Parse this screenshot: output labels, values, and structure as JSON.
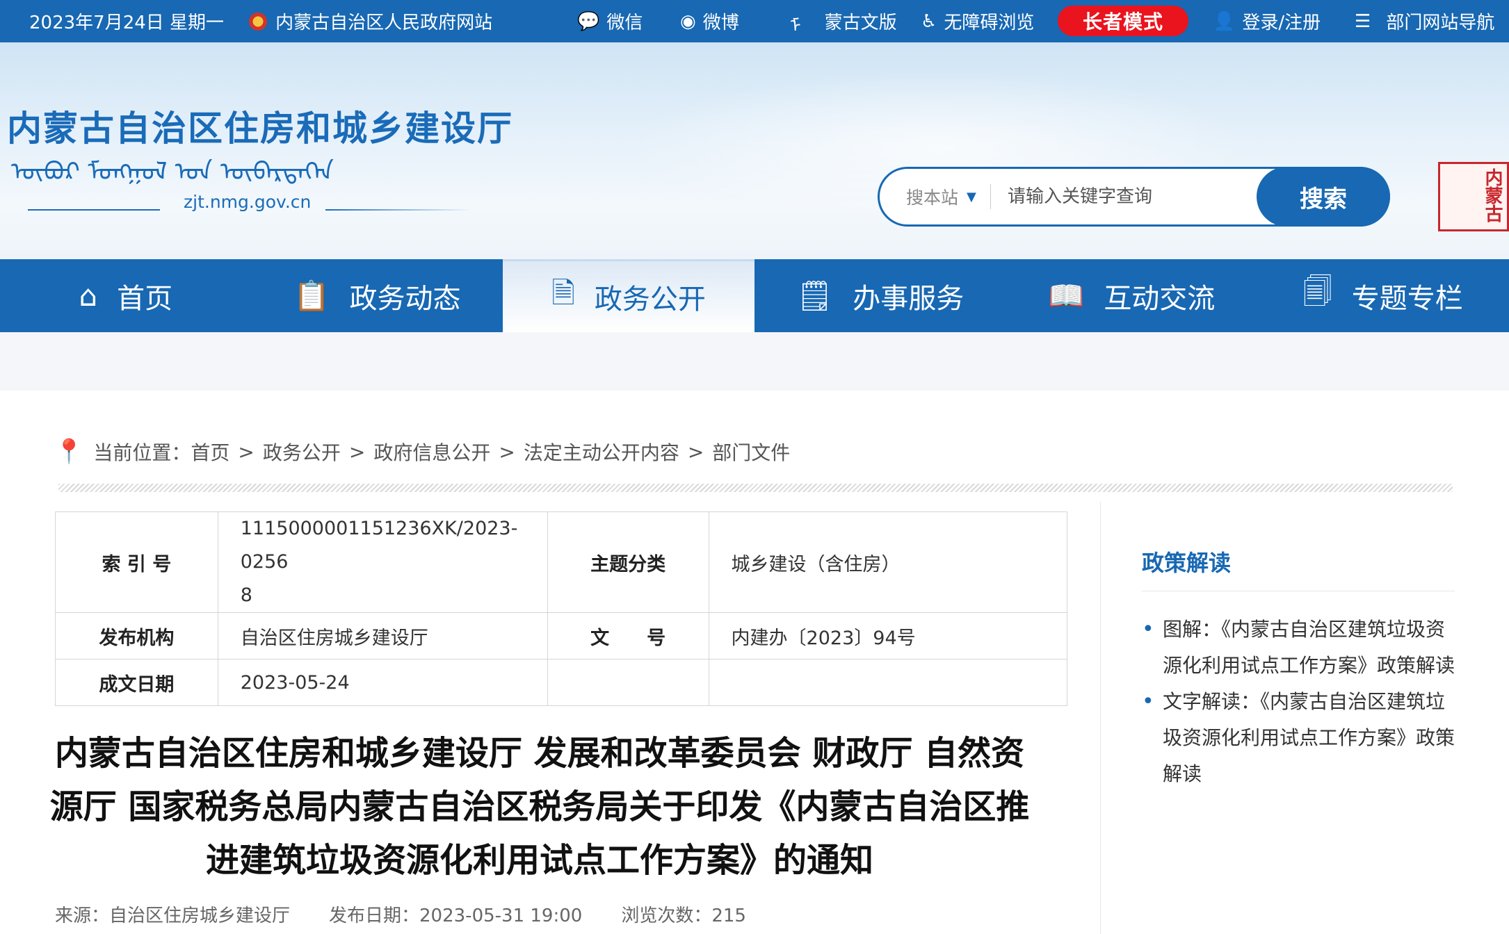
{
  "topbar": {
    "date": "2023年7月24日 星期一",
    "gov_site": "内蒙古自治区人民政府网站",
    "wechat": "微信",
    "weibo": "微博",
    "mongol_version": "蒙古文版",
    "accessible": "无障碍浏览",
    "elder_mode": "长者模式",
    "login": "登录/注册",
    "dept_nav": "部门网站导航"
  },
  "header": {
    "title": "内蒙古自治区住房和城乡建设厅",
    "mongol_script": "ᠥᠪᠦᠷ ᠮᠣᠩᠭᠣᠯ ᠤᠨ ᠥᠪᠡᠷᠲᠡᠭᠡᠨ",
    "domain": "zjt.nmg.gov.cn",
    "seal_text": "内蒙古"
  },
  "search": {
    "scope": "搜本站",
    "placeholder": "请输入关键字查询",
    "button": "搜索"
  },
  "nav": {
    "items": [
      {
        "label": "首页",
        "icon": "home-icon",
        "glyph": "⌂"
      },
      {
        "label": "政务动态",
        "icon": "clipboard-icon",
        "glyph": "📋"
      },
      {
        "label": "政务公开",
        "icon": "document-icon",
        "glyph": "🗎"
      },
      {
        "label": "办事服务",
        "icon": "service-icon",
        "glyph": "🗒"
      },
      {
        "label": "互动交流",
        "icon": "book-icon",
        "glyph": "📖"
      },
      {
        "label": "专题专栏",
        "icon": "topics-icon",
        "glyph": "🗐"
      }
    ],
    "active_index": 2
  },
  "breadcrumb": {
    "prefix": "当前位置：",
    "items": [
      "首页",
      "政务公开",
      "政府信息公开",
      "法定主动公开内容",
      "部门文件"
    ]
  },
  "meta": {
    "index_no_label": "索 引 号",
    "index_no": "111500000115123 6XK/2023-02568",
    "index_no_line1": "1115000001151236XK/2023-0256",
    "index_no_line2": "8",
    "topic_label": "主题分类",
    "topic": "城乡建设（含住房）",
    "publisher_label": "发布机构",
    "publisher": "自治区住房城乡建设厅",
    "doc_no_label": "文　　号",
    "doc_no": "内建办〔2023〕94号",
    "date_label": "成文日期",
    "date": "2023-05-24"
  },
  "article": {
    "title": "内蒙古自治区住房和城乡建设厅 发展和改革委员会 财政厅 自然资源厅 国家税务总局内蒙古自治区税务局关于印发《内蒙古自治区推进建筑垃圾资源化利用试点工作方案》的通知",
    "source": "来源：自治区住房城乡建设厅",
    "published": "发布日期：2023-05-31 19:00",
    "views": "浏览次数：215"
  },
  "sidebar": {
    "title": "政策解读",
    "items": [
      "图解：《内蒙古自治区建筑垃圾资源化利用试点工作方案》政策解读",
      "文字解读：《内蒙古自治区建筑垃圾资源化利用试点工作方案》政策解读"
    ]
  },
  "colors": {
    "primary": "#1868b3",
    "elder_button": "#e9141e",
    "seal": "#c8262c"
  }
}
